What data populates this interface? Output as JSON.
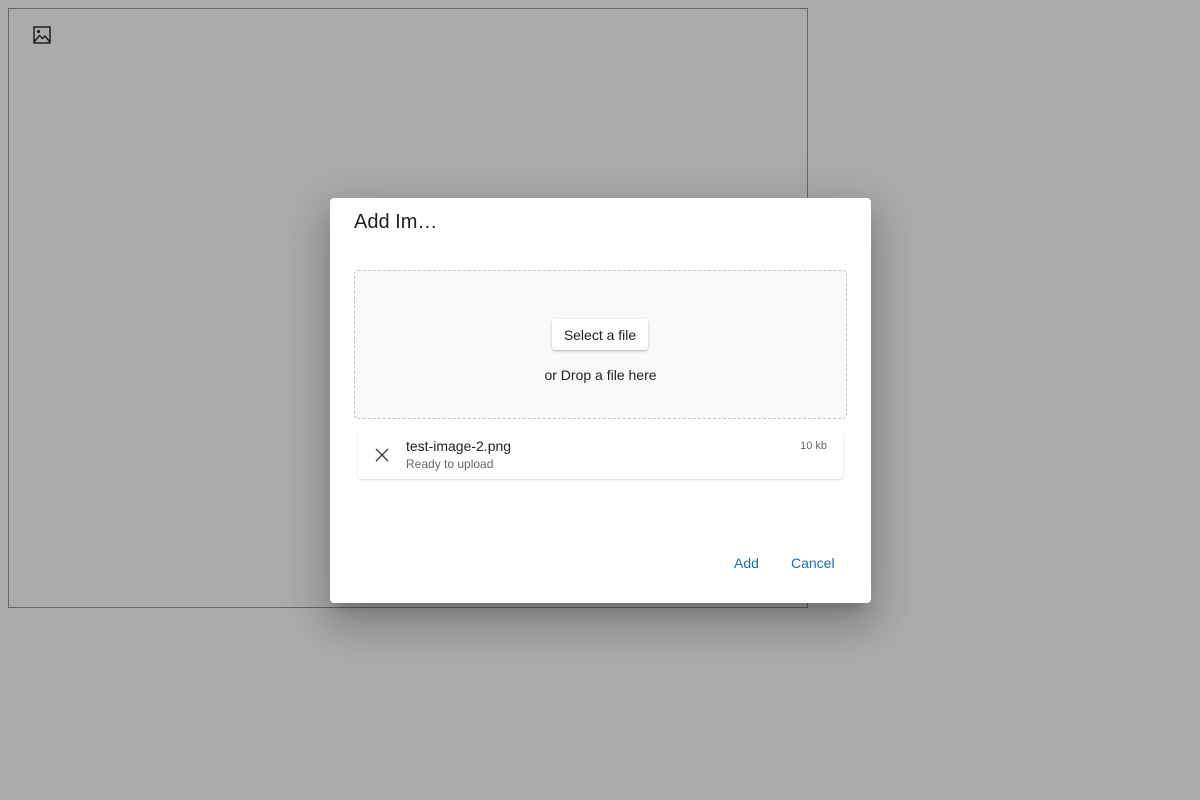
{
  "editor": {
    "toolbar": {
      "image_icon": "image-icon"
    }
  },
  "dialog": {
    "title": "Add Im…",
    "dropzone": {
      "select_label": "Select a file",
      "drop_text": "or Drop a file here"
    },
    "file": {
      "name": "test-image-2.png",
      "status": "Ready to upload",
      "size": "10 kb",
      "remove_icon": "close-icon"
    },
    "actions": {
      "add_label": "Add",
      "cancel_label": "Cancel"
    }
  },
  "colors": {
    "accent": "#1a6fa8",
    "overlay": "rgba(0,0,0,0.33)"
  }
}
